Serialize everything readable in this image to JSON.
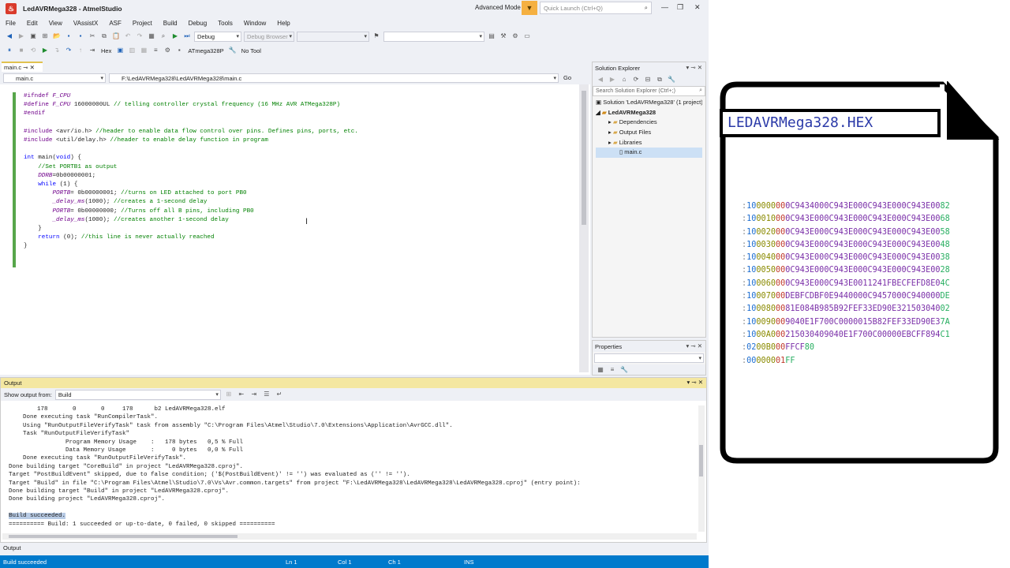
{
  "window": {
    "title": "LedAVRMega328 - AtmelStudio",
    "advanced_mode": "Advanced Mode",
    "quick_launch_placeholder": "Quick Launch (Ctrl+Q)"
  },
  "menu": [
    "File",
    "Edit",
    "View",
    "VAssistX",
    "ASF",
    "Project",
    "Build",
    "Debug",
    "Tools",
    "Window",
    "Help"
  ],
  "toolbar": {
    "config": "Debug",
    "debug_browser": "Debug Browser",
    "hex_label": "Hex",
    "device": "ATmega328P",
    "tool": "No Tool"
  },
  "editor": {
    "tab_label": "main.c",
    "file_dropdown": "main.c",
    "path_dropdown": "F:\\LedAVRMega328\\LedAVRMega328\\main.c",
    "go_label": "Go",
    "code_lines": [
      "#ifndef F_CPU",
      "#define F_CPU 16000000UL // telling controller crystal frequency (16 MHz AVR ATMega328P)",
      "#endif",
      "",
      "#include <avr/io.h> //header to enable data flow control over pins. Defines pins, ports, etc.",
      "#include <util/delay.h> //header to enable delay function in program",
      "",
      "int main(void) {",
      "    //Set PORTB1 as output",
      "    DDRB=0b00000001;",
      "    while (1) {",
      "        PORTB= 0b00000001; //turns on LED attached to port PB0",
      "        _delay_ms(1000); //creates a 1-second delay",
      "        PORTB= 0b00000000; //Turns off all B pins, including PB0",
      "        _delay_ms(1000); //creates another 1-second delay",
      "    }",
      "    return (0); //this line is never actually reached",
      "}"
    ]
  },
  "solution_explorer": {
    "title": "Solution Explorer",
    "search_placeholder": "Search Solution Explorer (Ctrl+;)",
    "items": [
      "Solution 'LedAVRMega328' (1 project)",
      "LedAVRMega328",
      "Dependencies",
      "Output Files",
      "Libraries",
      "main.c"
    ]
  },
  "properties": {
    "title": "Properties"
  },
  "output": {
    "title": "Output",
    "show_from_label": "Show output from:",
    "source": "Build",
    "lines": [
      "        178       0       0     178      b2 LedAVRMega328.elf",
      "    Done executing task \"RunCompilerTask\".",
      "    Using \"RunOutputFileVerifyTask\" task from assembly \"C:\\Program Files\\Atmel\\Studio\\7.0\\Extensions\\Application\\AvrGCC.dll\".",
      "    Task \"RunOutputFileVerifyTask\"",
      "                Program Memory Usage    :   178 bytes   0,5 % Full",
      "                Data Memory Usage       :     0 bytes   0,0 % Full",
      "    Done executing task \"RunOutputFileVerifyTask\".",
      "Done building target \"CoreBuild\" in project \"LedAVRMega328.cproj\".",
      "Target \"PostBuildEvent\" skipped, due to false condition; ('$(PostBuildEvent)' != '') was evaluated as ('' != '').",
      "Target \"Build\" in file \"C:\\Program Files\\Atmel\\Studio\\7.0\\Vs\\Avr.common.targets\" from project \"F:\\LedAVRMega328\\LedAVRMega328\\LedAVRMega328.cproj\" (entry point):",
      "Done building target \"Build\" in project \"LedAVRMega328.cproj\".",
      "Done building project \"LedAVRMega328.cproj\".",
      "",
      "Build succeeded.",
      "========== Build: 1 succeeded or up-to-date, 0 failed, 0 skipped =========="
    ],
    "bottom_tab": "Output"
  },
  "status": {
    "message": "Build succeeded",
    "ln": "Ln 1",
    "col": "Col 1",
    "ch": "Ch 1",
    "mode": "INS"
  },
  "hex_file": {
    "filename": "LEDAVRMega328.HEX",
    "records": [
      [
        ":",
        "10",
        "0000",
        "00",
        "0C9434000C943E000C943E000C943E00",
        "82"
      ],
      [
        ":",
        "10",
        "0010",
        "00",
        "0C943E000C943E000C943E000C943E00",
        "68"
      ],
      [
        ":",
        "10",
        "0020",
        "00",
        "0C943E000C943E000C943E000C943E00",
        "58"
      ],
      [
        ":",
        "10",
        "0030",
        "00",
        "0C943E000C943E000C943E000C943E00",
        "48"
      ],
      [
        ":",
        "10",
        "0040",
        "00",
        "0C943E000C943E000C943E000C943E00",
        "38"
      ],
      [
        ":",
        "10",
        "0050",
        "00",
        "0C943E000C943E000C943E000C943E00",
        "28"
      ],
      [
        ":",
        "10",
        "0060",
        "00",
        "0C943E000C943E0011241FBECFEFD8E0",
        "4C"
      ],
      [
        ":",
        "10",
        "0070",
        "00",
        "DEBFCDBF0E9440000C9457000C940000",
        "DE"
      ],
      [
        ":",
        "10",
        "0080",
        "00",
        "81E084B985B92FEF33ED90E321503040",
        "02"
      ],
      [
        ":",
        "10",
        "0090",
        "00",
        "9040E1F700C0000015B82FEF33ED90E3",
        "7A"
      ],
      [
        ":",
        "10",
        "00A0",
        "00",
        "215030409040E1F700C00000EBCFF894",
        "C1"
      ],
      [
        ":",
        "02",
        "00B0",
        "00",
        "FFCF",
        "80"
      ],
      [
        ":",
        "00",
        "0000",
        "01",
        "",
        "FF"
      ]
    ]
  }
}
